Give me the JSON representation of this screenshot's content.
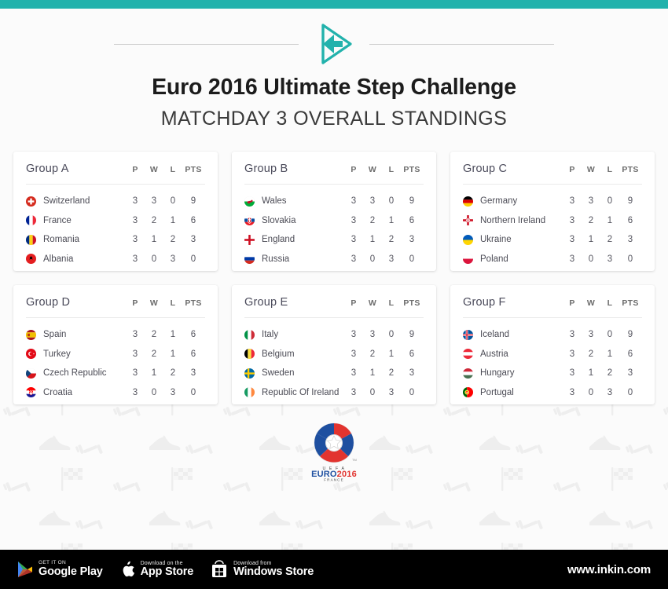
{
  "theme": {
    "accent": "#22b2ac",
    "page_bg": "#fbfbfb",
    "card_bg": "#ffffff",
    "footer_bg": "#000000",
    "text": "#1c1c1c"
  },
  "header": {
    "logo_name": "inkin-logo",
    "title": "Euro 2016 Ultimate Step Challenge",
    "subtitle": "MATCHDAY 3 OVERALL STANDINGS"
  },
  "columns": {
    "p": "P",
    "w": "W",
    "l": "L",
    "pts": "PTS"
  },
  "groups": [
    {
      "name": "Group A",
      "rows": [
        {
          "flag": "switzerland",
          "team": "Switzerland",
          "p": "3",
          "w": "3",
          "l": "0",
          "pts": "9"
        },
        {
          "flag": "france",
          "team": "France",
          "p": "3",
          "w": "2",
          "l": "1",
          "pts": "6"
        },
        {
          "flag": "romania",
          "team": "Romania",
          "p": "3",
          "w": "1",
          "l": "2",
          "pts": "3"
        },
        {
          "flag": "albania",
          "team": "Albania",
          "p": "3",
          "w": "0",
          "l": "3",
          "pts": "0"
        }
      ]
    },
    {
      "name": "Group B",
      "rows": [
        {
          "flag": "wales",
          "team": "Wales",
          "p": "3",
          "w": "3",
          "l": "0",
          "pts": "9"
        },
        {
          "flag": "slovakia",
          "team": "Slovakia",
          "p": "3",
          "w": "2",
          "l": "1",
          "pts": "6"
        },
        {
          "flag": "england",
          "team": "England",
          "p": "3",
          "w": "1",
          "l": "2",
          "pts": "3"
        },
        {
          "flag": "russia",
          "team": "Russia",
          "p": "3",
          "w": "0",
          "l": "3",
          "pts": "0"
        }
      ]
    },
    {
      "name": "Group C",
      "rows": [
        {
          "flag": "germany",
          "team": "Germany",
          "p": "3",
          "w": "3",
          "l": "0",
          "pts": "9"
        },
        {
          "flag": "northern-ireland",
          "team": "Northern Ireland",
          "p": "3",
          "w": "2",
          "l": "1",
          "pts": "6"
        },
        {
          "flag": "ukraine",
          "team": "Ukraine",
          "p": "3",
          "w": "1",
          "l": "2",
          "pts": "3"
        },
        {
          "flag": "poland",
          "team": "Poland",
          "p": "3",
          "w": "0",
          "l": "3",
          "pts": "0"
        }
      ]
    },
    {
      "name": "Group D",
      "rows": [
        {
          "flag": "spain",
          "team": "Spain",
          "p": "3",
          "w": "2",
          "l": "1",
          "pts": "6"
        },
        {
          "flag": "turkey",
          "team": "Turkey",
          "p": "3",
          "w": "2",
          "l": "1",
          "pts": "6"
        },
        {
          "flag": "czech-republic",
          "team": "Czech Republic",
          "p": "3",
          "w": "1",
          "l": "2",
          "pts": "3"
        },
        {
          "flag": "croatia",
          "team": "Croatia",
          "p": "3",
          "w": "0",
          "l": "3",
          "pts": "0"
        }
      ]
    },
    {
      "name": "Group E",
      "rows": [
        {
          "flag": "italy",
          "team": "Italy",
          "p": "3",
          "w": "3",
          "l": "0",
          "pts": "9"
        },
        {
          "flag": "belgium",
          "team": "Belgium",
          "p": "3",
          "w": "2",
          "l": "1",
          "pts": "6"
        },
        {
          "flag": "sweden",
          "team": "Sweden",
          "p": "3",
          "w": "1",
          "l": "2",
          "pts": "3"
        },
        {
          "flag": "republic-of-ireland",
          "team": "Republic Of Ireland",
          "p": "3",
          "w": "0",
          "l": "3",
          "pts": "0"
        }
      ]
    },
    {
      "name": "Group F",
      "rows": [
        {
          "flag": "iceland",
          "team": "Iceland",
          "p": "3",
          "w": "3",
          "l": "0",
          "pts": "9"
        },
        {
          "flag": "austria",
          "team": "Austria",
          "p": "3",
          "w": "2",
          "l": "1",
          "pts": "6"
        },
        {
          "flag": "hungary",
          "team": "Hungary",
          "p": "3",
          "w": "1",
          "l": "2",
          "pts": "3"
        },
        {
          "flag": "portugal",
          "team": "Portugal",
          "p": "3",
          "w": "0",
          "l": "3",
          "pts": "0"
        }
      ]
    }
  ],
  "euro_logo": {
    "name": "uefa-euro-2016-france-logo",
    "uefa": "UEFA",
    "euro": "EURO",
    "year": "2016",
    "country": "FRANCE",
    "tm": "TM"
  },
  "footer": {
    "badges": [
      {
        "icon": "google-play-icon",
        "small": "GET IT ON",
        "big": "Google Play"
      },
      {
        "icon": "apple-icon",
        "small": "Download on the",
        "big": "App Store"
      },
      {
        "icon": "windows-store-icon",
        "small": "Download from",
        "big": "Windows Store"
      }
    ],
    "site": "www.inkin.com"
  }
}
